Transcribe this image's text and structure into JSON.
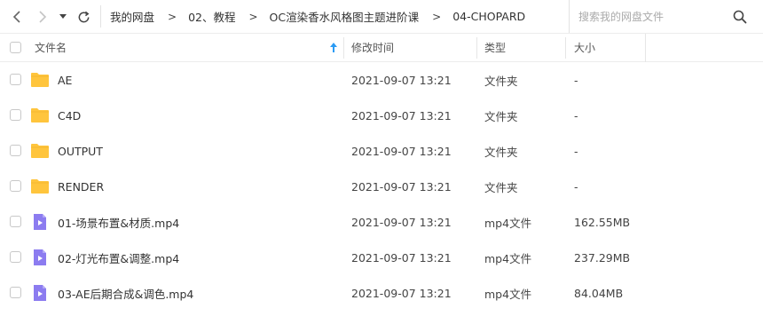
{
  "nav": {
    "back_icon": "chevron-left-icon",
    "forward_icon": "chevron-right-icon",
    "dropdown_icon": "caret-down-icon",
    "refresh_icon": "refresh-icon"
  },
  "breadcrumb": {
    "items": [
      "我的网盘",
      "02、教程",
      "OC渲染香水风格图主题进阶课",
      "04-CHOPARD"
    ],
    "separator": ">"
  },
  "search": {
    "placeholder": "搜索我的网盘文件",
    "icon": "search-icon"
  },
  "table": {
    "columns": {
      "name": "文件名",
      "modified": "修改时间",
      "type": "类型",
      "size": "大小"
    },
    "sort_icon": "sort-arrow-up-icon",
    "rows": [
      {
        "name": "AE",
        "modified": "2021-09-07 13:21",
        "type": "文件夹",
        "size": "-",
        "icon": "folder-icon"
      },
      {
        "name": "C4D",
        "modified": "2021-09-07 13:21",
        "type": "文件夹",
        "size": "-",
        "icon": "folder-icon"
      },
      {
        "name": "OUTPUT",
        "modified": "2021-09-07 13:21",
        "type": "文件夹",
        "size": "-",
        "icon": "folder-icon"
      },
      {
        "name": "RENDER",
        "modified": "2021-09-07 13:21",
        "type": "文件夹",
        "size": "-",
        "icon": "folder-icon"
      },
      {
        "name": "01-场景布置&材质.mp4",
        "modified": "2021-09-07 13:21",
        "type": "mp4文件",
        "size": "162.55MB",
        "icon": "video-file-icon"
      },
      {
        "name": "02-灯光布置&调整.mp4",
        "modified": "2021-09-07 13:21",
        "type": "mp4文件",
        "size": "237.29MB",
        "icon": "video-file-icon"
      },
      {
        "name": "03-AE后期合成&调色.mp4",
        "modified": "2021-09-07 13:21",
        "type": "mp4文件",
        "size": "84.04MB",
        "icon": "video-file-icon"
      }
    ]
  },
  "colors": {
    "folder": "#FFC53D",
    "video": "#8C7CF0",
    "sort_arrow": "#2B9BF4"
  }
}
